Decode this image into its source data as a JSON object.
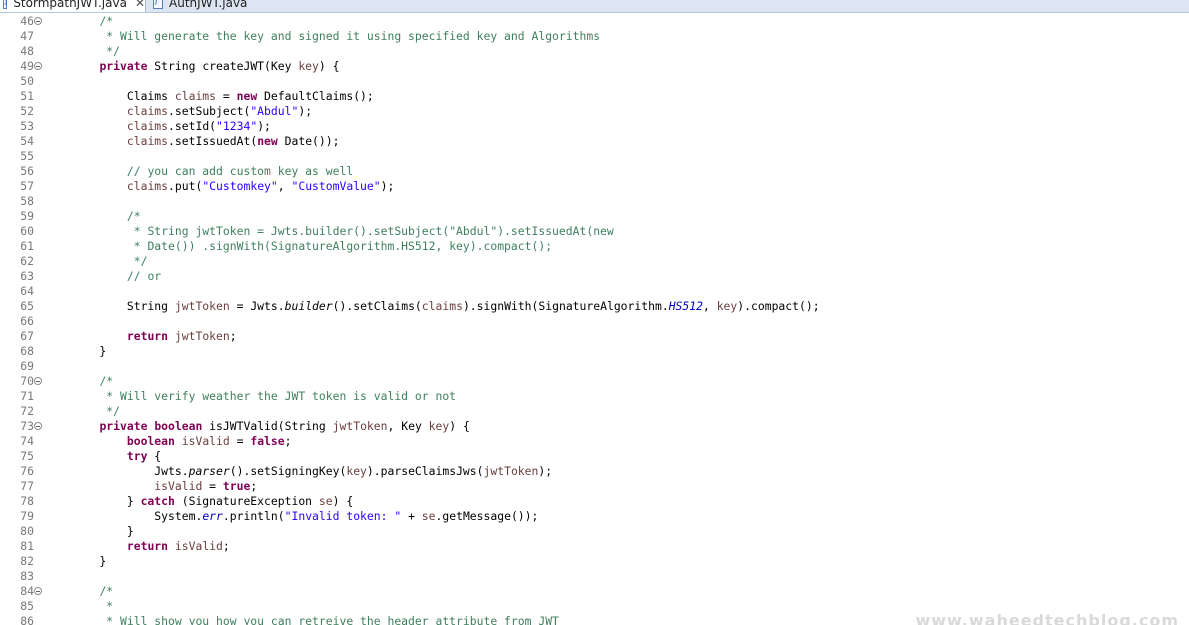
{
  "tabs": [
    {
      "label": "StormpathJWT.java",
      "icon": "java-file-icon",
      "active": true
    },
    {
      "label": "AuthJWT.java",
      "icon": "java-file-icon",
      "active": false
    }
  ],
  "watermark": "www.waheedtechblog.com",
  "colors": {
    "comment": "#3f7f5f",
    "keyword": "#7f0055",
    "string": "#2a00ff",
    "local_variable": "#6a3e3e",
    "static_field": "#0000c0",
    "line_number": "#787878"
  },
  "lines": [
    {
      "num": "46",
      "fold": true,
      "tokens": [
        {
          "t": "    "
        },
        {
          "t": "/*",
          "c": "comment"
        }
      ]
    },
    {
      "num": "47",
      "tokens": [
        {
          "t": "     "
        },
        {
          "t": "* Will generate the key and signed it using specified key and Algorithms",
          "c": "comment"
        }
      ]
    },
    {
      "num": "48",
      "tokens": [
        {
          "t": "     "
        },
        {
          "t": "*/",
          "c": "comment"
        }
      ]
    },
    {
      "num": "49",
      "fold": true,
      "tokens": [
        {
          "t": "    "
        },
        {
          "t": "private",
          "c": "keyword"
        },
        {
          "t": " String createJWT(Key "
        },
        {
          "t": "key",
          "c": "local"
        },
        {
          "t": ") {"
        }
      ]
    },
    {
      "num": "50",
      "tokens": []
    },
    {
      "num": "51",
      "tokens": [
        {
          "t": "        Claims "
        },
        {
          "t": "claims",
          "c": "local"
        },
        {
          "t": " = "
        },
        {
          "t": "new",
          "c": "keyword"
        },
        {
          "t": " DefaultClaims();"
        }
      ]
    },
    {
      "num": "52",
      "tokens": [
        {
          "t": "        "
        },
        {
          "t": "claims",
          "c": "local"
        },
        {
          "t": ".setSubject("
        },
        {
          "t": "\"Abdul\"",
          "c": "string"
        },
        {
          "t": ");"
        }
      ]
    },
    {
      "num": "53",
      "tokens": [
        {
          "t": "        "
        },
        {
          "t": "claims",
          "c": "local"
        },
        {
          "t": ".setId("
        },
        {
          "t": "\"1234\"",
          "c": "string"
        },
        {
          "t": ");"
        }
      ]
    },
    {
      "num": "54",
      "tokens": [
        {
          "t": "        "
        },
        {
          "t": "claims",
          "c": "local"
        },
        {
          "t": ".setIssuedAt("
        },
        {
          "t": "new",
          "c": "keyword"
        },
        {
          "t": " Date());"
        }
      ]
    },
    {
      "num": "55",
      "tokens": []
    },
    {
      "num": "56",
      "tokens": [
        {
          "t": "        "
        },
        {
          "t": "// you can add custom key as well",
          "c": "comment"
        }
      ]
    },
    {
      "num": "57",
      "tokens": [
        {
          "t": "        "
        },
        {
          "t": "claims",
          "c": "local"
        },
        {
          "t": ".put("
        },
        {
          "t": "\"Customkey\"",
          "c": "string"
        },
        {
          "t": ", "
        },
        {
          "t": "\"CustomValue\"",
          "c": "string"
        },
        {
          "t": ");"
        }
      ]
    },
    {
      "num": "58",
      "tokens": []
    },
    {
      "num": "59",
      "tokens": [
        {
          "t": "        "
        },
        {
          "t": "/*",
          "c": "comment"
        }
      ]
    },
    {
      "num": "60",
      "tokens": [
        {
          "t": "         "
        },
        {
          "t": "* String jwtToken = Jwts.builder().setSubject(\"Abdul\").setIssuedAt(new",
          "c": "comment"
        }
      ]
    },
    {
      "num": "61",
      "tokens": [
        {
          "t": "         "
        },
        {
          "t": "* Date()) .signWith(SignatureAlgorithm.HS512, key).compact();",
          "c": "comment"
        }
      ]
    },
    {
      "num": "62",
      "tokens": [
        {
          "t": "         "
        },
        {
          "t": "*/",
          "c": "comment"
        }
      ]
    },
    {
      "num": "63",
      "tokens": [
        {
          "t": "        "
        },
        {
          "t": "// or",
          "c": "comment"
        }
      ]
    },
    {
      "num": "64",
      "tokens": []
    },
    {
      "num": "65",
      "tokens": [
        {
          "t": "        String "
        },
        {
          "t": "jwtToken",
          "c": "local"
        },
        {
          "t": " = Jwts."
        },
        {
          "t": "builder",
          "c": "static"
        },
        {
          "t": "().setClaims("
        },
        {
          "t": "claims",
          "c": "local"
        },
        {
          "t": ").signWith(SignatureAlgorithm."
        },
        {
          "t": "HS512",
          "c": "field"
        },
        {
          "t": ", "
        },
        {
          "t": "key",
          "c": "local"
        },
        {
          "t": ").compact();"
        }
      ]
    },
    {
      "num": "66",
      "tokens": []
    },
    {
      "num": "67",
      "tokens": [
        {
          "t": "        "
        },
        {
          "t": "return",
          "c": "keyword"
        },
        {
          "t": " "
        },
        {
          "t": "jwtToken",
          "c": "local"
        },
        {
          "t": ";"
        }
      ]
    },
    {
      "num": "68",
      "tokens": [
        {
          "t": "    }"
        }
      ]
    },
    {
      "num": "69",
      "tokens": []
    },
    {
      "num": "70",
      "fold": true,
      "tokens": [
        {
          "t": "    "
        },
        {
          "t": "/*",
          "c": "comment"
        }
      ]
    },
    {
      "num": "71",
      "tokens": [
        {
          "t": "     "
        },
        {
          "t": "* Will verify weather the JWT token is valid or not",
          "c": "comment"
        }
      ]
    },
    {
      "num": "72",
      "tokens": [
        {
          "t": "     "
        },
        {
          "t": "*/",
          "c": "comment"
        }
      ]
    },
    {
      "num": "73",
      "fold": true,
      "tokens": [
        {
          "t": "    "
        },
        {
          "t": "private",
          "c": "keyword"
        },
        {
          "t": " "
        },
        {
          "t": "boolean",
          "c": "keyword"
        },
        {
          "t": " isJWTValid(String "
        },
        {
          "t": "jwtToken",
          "c": "local"
        },
        {
          "t": ", Key "
        },
        {
          "t": "key",
          "c": "local"
        },
        {
          "t": ") {"
        }
      ]
    },
    {
      "num": "74",
      "tokens": [
        {
          "t": "        "
        },
        {
          "t": "boolean",
          "c": "keyword"
        },
        {
          "t": " "
        },
        {
          "t": "isValid",
          "c": "local"
        },
        {
          "t": " = "
        },
        {
          "t": "false",
          "c": "keyword"
        },
        {
          "t": ";"
        }
      ]
    },
    {
      "num": "75",
      "tokens": [
        {
          "t": "        "
        },
        {
          "t": "try",
          "c": "keyword"
        },
        {
          "t": " {"
        }
      ]
    },
    {
      "num": "76",
      "tokens": [
        {
          "t": "            Jwts."
        },
        {
          "t": "parser",
          "c": "static"
        },
        {
          "t": "().setSigningKey("
        },
        {
          "t": "key",
          "c": "local"
        },
        {
          "t": ").parseClaimsJws("
        },
        {
          "t": "jwtToken",
          "c": "local"
        },
        {
          "t": ");"
        }
      ]
    },
    {
      "num": "77",
      "tokens": [
        {
          "t": "            "
        },
        {
          "t": "isValid",
          "c": "local"
        },
        {
          "t": " = "
        },
        {
          "t": "true",
          "c": "keyword"
        },
        {
          "t": ";"
        }
      ]
    },
    {
      "num": "78",
      "tokens": [
        {
          "t": "        } "
        },
        {
          "t": "catch",
          "c": "keyword"
        },
        {
          "t": " (SignatureException "
        },
        {
          "t": "se",
          "c": "local"
        },
        {
          "t": ") {"
        }
      ]
    },
    {
      "num": "79",
      "tokens": [
        {
          "t": "            System."
        },
        {
          "t": "err",
          "c": "field"
        },
        {
          "t": ".println("
        },
        {
          "t": "\"Invalid token: \"",
          "c": "string"
        },
        {
          "t": " + "
        },
        {
          "t": "se",
          "c": "local"
        },
        {
          "t": ".getMessage());"
        }
      ]
    },
    {
      "num": "80",
      "tokens": [
        {
          "t": "        }"
        }
      ]
    },
    {
      "num": "81",
      "tokens": [
        {
          "t": "        "
        },
        {
          "t": "return",
          "c": "keyword"
        },
        {
          "t": " "
        },
        {
          "t": "isValid",
          "c": "local"
        },
        {
          "t": ";"
        }
      ]
    },
    {
      "num": "82",
      "tokens": [
        {
          "t": "    }"
        }
      ]
    },
    {
      "num": "83",
      "tokens": []
    },
    {
      "num": "84",
      "fold": true,
      "tokens": [
        {
          "t": "    "
        },
        {
          "t": "/*",
          "c": "comment"
        }
      ]
    },
    {
      "num": "85",
      "tokens": [
        {
          "t": "     "
        },
        {
          "t": "*",
          "c": "comment"
        }
      ]
    },
    {
      "num": "86",
      "tokens": [
        {
          "t": "     "
        },
        {
          "t": "* Will show you how you can retreive the header attribute from JWT",
          "c": "comment"
        }
      ]
    }
  ]
}
